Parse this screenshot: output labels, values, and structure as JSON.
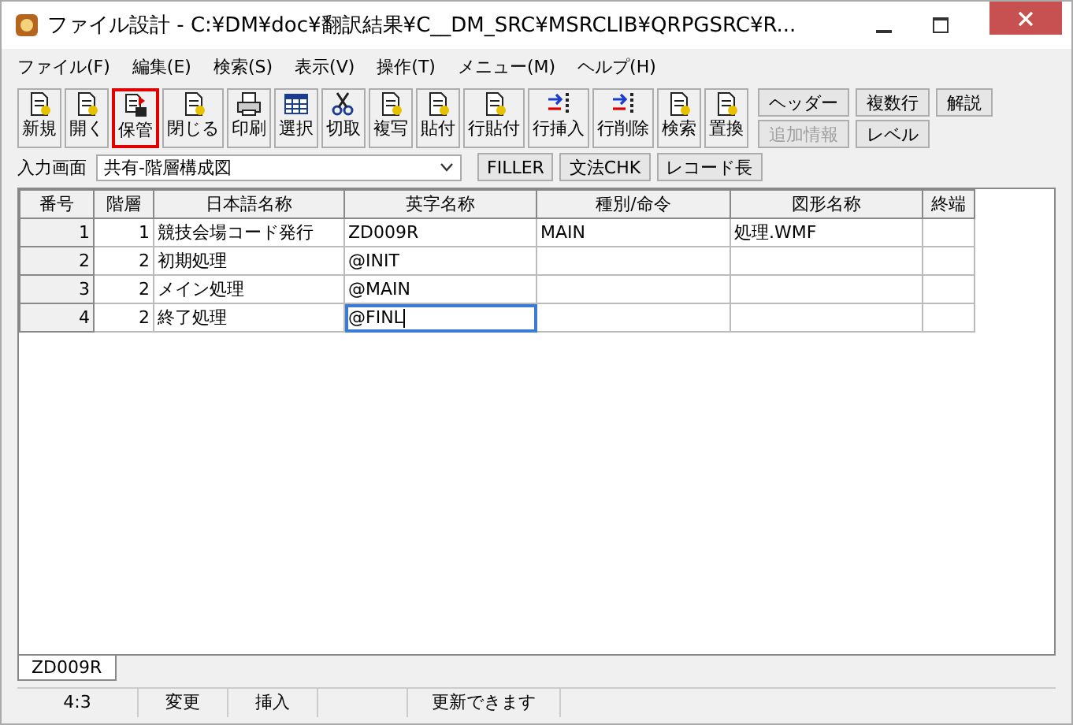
{
  "window": {
    "title": "ファイル設計 - C:¥DM¥doc¥翻訳結果¥C__DM_SRC¥MSRCLIB¥QRPGSRC¥R..."
  },
  "menu": [
    "ファイル(F)",
    "編集(E)",
    "検索(S)",
    "表示(V)",
    "操作(T)",
    "メニュー(M)",
    "ヘルプ(H)"
  ],
  "toolbar": [
    {
      "label": "新規",
      "highlighted": false
    },
    {
      "label": "開く",
      "highlighted": false
    },
    {
      "label": "保管",
      "highlighted": true
    },
    {
      "label": "閉じる",
      "highlighted": false
    },
    {
      "label": "印刷",
      "highlighted": false
    },
    {
      "label": "選択",
      "highlighted": false
    },
    {
      "label": "切取",
      "highlighted": false
    },
    {
      "label": "複写",
      "highlighted": false
    },
    {
      "label": "貼付",
      "highlighted": false
    },
    {
      "label": "行貼付",
      "highlighted": false
    },
    {
      "label": "行挿入",
      "highlighted": false
    },
    {
      "label": "行削除",
      "highlighted": false
    },
    {
      "label": "検索",
      "highlighted": false
    },
    {
      "label": "置換",
      "highlighted": false
    }
  ],
  "side_buttons": [
    {
      "label": "ヘッダー",
      "disabled": false
    },
    {
      "label": "複数行",
      "disabled": false
    },
    {
      "label": "解説",
      "disabled": false
    },
    {
      "label": "追加情報",
      "disabled": true
    },
    {
      "label": "レベル",
      "disabled": false
    }
  ],
  "input_screen": {
    "label": "入力画面",
    "value": "共有-階層構成図",
    "buttons": [
      "FILLER",
      "文法CHK",
      "レコード長"
    ]
  },
  "table": {
    "columns": [
      "番号",
      "階層",
      "日本語名称",
      "英字名称",
      "種別/命令",
      "図形名称",
      "終端"
    ],
    "rows": [
      {
        "cells": [
          "1",
          "1",
          "競技会場コード発行",
          "ZD009R",
          "MAIN",
          "処理.WMF",
          ""
        ],
        "editing": false
      },
      {
        "cells": [
          "2",
          "2",
          "初期処理",
          "@INIT",
          "",
          "",
          ""
        ],
        "editing": false
      },
      {
        "cells": [
          "3",
          "2",
          "メイン処理",
          "@MAIN",
          "",
          "",
          ""
        ],
        "editing": false
      },
      {
        "cells": [
          "4",
          "2",
          "終了処理",
          "@FINL",
          "",
          "",
          ""
        ],
        "editing": true
      }
    ]
  },
  "sheet_tabs": [
    {
      "label": "ZD009R",
      "selected": true
    }
  ],
  "status_bar": [
    "4:3",
    "変更",
    "挿入",
    "更新できます"
  ]
}
